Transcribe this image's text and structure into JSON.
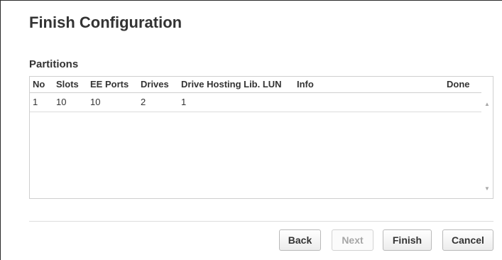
{
  "page": {
    "title": "Finish Configuration"
  },
  "partitions": {
    "section_title": "Partitions",
    "columns": {
      "no": "No",
      "slots": "Slots",
      "ee_ports": "EE Ports",
      "drives": "Drives",
      "drive_hosting_lun": "Drive Hosting Lib. LUN",
      "info": "Info",
      "done": "Done"
    },
    "rows": [
      {
        "no": "1",
        "slots": "10",
        "ee_ports": "10",
        "drives": "2",
        "drive_hosting_lun": "1",
        "info": "",
        "done": ""
      }
    ],
    "scrollbar": {
      "up_icon": "▲",
      "down_icon": "▼"
    }
  },
  "footer": {
    "back_label": "Back",
    "next_label": "Next",
    "finish_label": "Finish",
    "cancel_label": "Cancel",
    "next_disabled": true
  }
}
